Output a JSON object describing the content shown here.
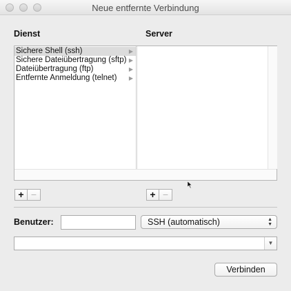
{
  "window": {
    "title": "Neue entfernte Verbindung"
  },
  "columns": {
    "service_label": "Dienst",
    "server_label": "Server"
  },
  "services": [
    {
      "label": "Sichere Shell (ssh)",
      "selected": true
    },
    {
      "label": "Sichere Dateiübertragung (sftp)",
      "selected": false
    },
    {
      "label": "Dateiübertragung (ftp)",
      "selected": false
    },
    {
      "label": "Entfernte Anmeldung (telnet)",
      "selected": false
    }
  ],
  "buttons": {
    "add": "+",
    "remove": "−",
    "connect": "Verbinden"
  },
  "user": {
    "label": "Benutzer:",
    "value": "",
    "placeholder": ""
  },
  "protocol": {
    "selected": "SSH (automatisch)"
  },
  "address": {
    "value": "",
    "placeholder": ""
  },
  "icons": {
    "list_arrow": "triangle-right-icon",
    "updown": "updown-arrows-icon",
    "combo_arrow": "triangle-down-icon"
  },
  "colors": {
    "selection": "#dcdcdc",
    "window": "#ececec"
  }
}
